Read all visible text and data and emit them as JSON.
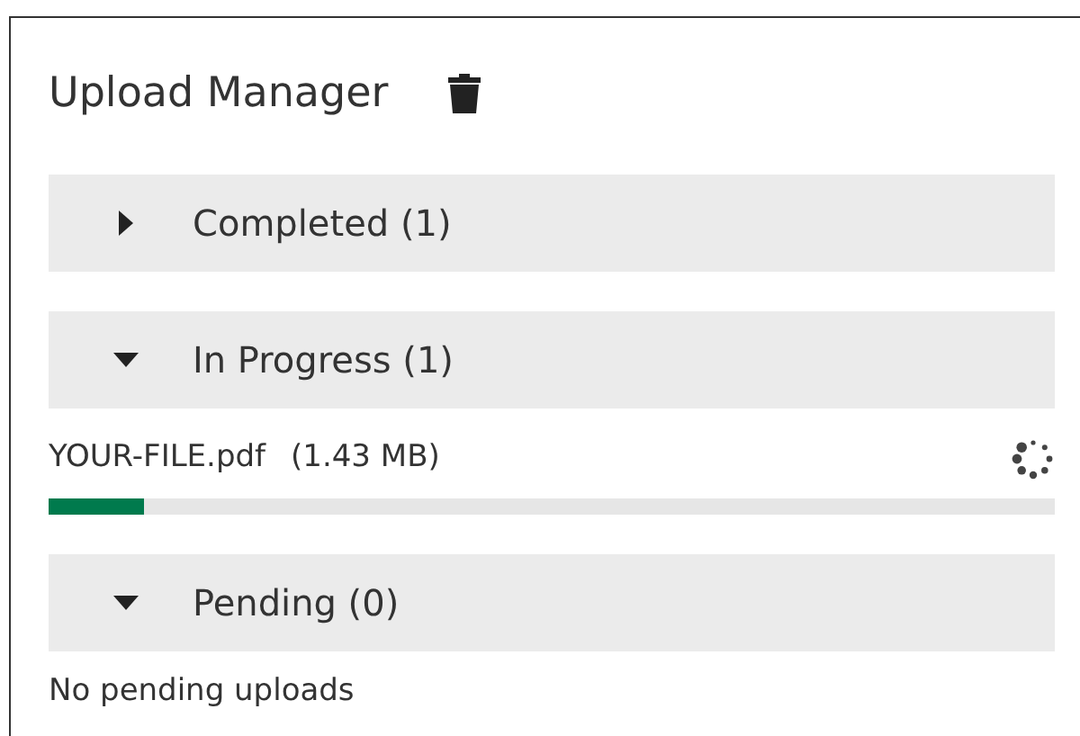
{
  "title": "Upload Manager",
  "sections": [
    {
      "label": "Completed (1)",
      "expanded": false
    },
    {
      "label": "In Progress (1)",
      "expanded": true,
      "files": [
        {
          "name": "YOUR-FILE.pdf",
          "size": "(1.43 MB)",
          "level": 0.095
        }
      ]
    },
    {
      "label": "Pending (0)",
      "expanded": true,
      "empty_text": "No pending uploads"
    }
  ]
}
